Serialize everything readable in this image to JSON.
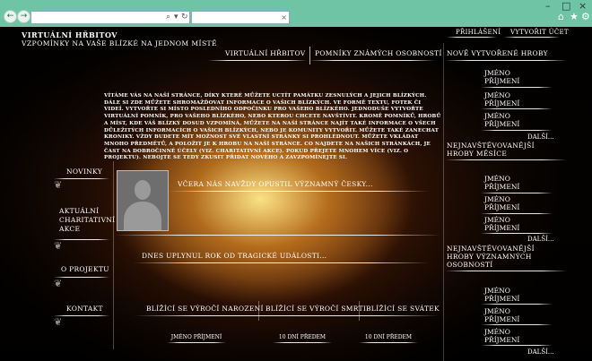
{
  "browser": {
    "back": "←",
    "forward": "→",
    "address_icons": [
      "⌕",
      "▾",
      "↻"
    ],
    "tab_close": "×",
    "window_controls": [
      "–",
      "□",
      "×"
    ],
    "toolbar_icons": [
      "⌂",
      "★",
      "⚙"
    ]
  },
  "header": {
    "logo_line1": "Virtuální hřbitov",
    "logo_line2": "Vzpomínky na vaše blízké na jednom místě",
    "login": "Přihlášení",
    "create_account": "Vytvořit účet"
  },
  "nav": {
    "tab1": "Virtuální hřbitov",
    "tab2": "Pomníky známých osobností"
  },
  "intro_text": "Vítáme Vás na naší stránce, díky které můžete uctít památku zesnulých a jejich blízkých. Dále si zde můžete shromažďovat informace o Vašich blízkých. Ve formě textu, fotek či videí. Vytvořte si místo posledního odpočinku pro Vašeho blízkého. Jednoduše vytvořte virtuální pomník, pro Vašeho blízkého, nebo kterou chcete navštívit. Kromě pomníků, hrobů a míst, kde váš blízký dosud vzpomíná, můžete na naší stránce najít také informace o všech důležitých informacích o vašich blízkých, nebo je komunity vytvořit. Můžete také zanechat kroniky. Vždy budete mít možnost své vlastní stránky si prohlédnout. Můžete vkládat mnoho předmětů, a položit je k hrobu na naší stránce. Co najdete na našich stránkách, je čast na dobročinné účely (viz. Charitativní akce). Pokud přejete mnohem více (viz. O projektu). Nebojte se tedy zkusit přidat nového a zavzpomínejte si.",
  "left_menu": {
    "news": "Novinky",
    "charity_line1": "Aktuální",
    "charity_line2": "charitativní",
    "charity_line3": "akce",
    "about": "O projektu",
    "contact": "Kontakt"
  },
  "news": {
    "item1": "Včera nás navždy opustil významný česky...",
    "item2": "Dnes uplynul rok od tragické události..."
  },
  "bottom": {
    "col1_title": "Blížící se výročí narození",
    "col2_title": "Blížící se výročí smrti",
    "col3_title": "Blížící se svátek",
    "col1_item": "Jméno Příjmení",
    "col2_item": "10 dní předem",
    "col3_item": "10 dní předem"
  },
  "sidebar": {
    "section1_title": "Nově vytvořené hroby",
    "section1_items": [
      {
        "first": "Jméno",
        "last": "Příjmení"
      },
      {
        "first": "Jméno",
        "last": "Příjmení"
      },
      {
        "first": "Jméno",
        "last": "Příjmení"
      }
    ],
    "section2_title_line1": "Nejnavštěvovanější",
    "section2_title_line2": "hroby měsíce",
    "section2_items": [
      {
        "first": "Jméno",
        "last": "Příjmení"
      },
      {
        "first": "Jméno",
        "last": "Příjmení"
      },
      {
        "first": "Jméno",
        "last": "Příjmení"
      }
    ],
    "section3_title_line1": "Nejnavštěvovanější",
    "section3_title_line2": "hroby významných",
    "section3_title_line3": "osobností",
    "section3_items": [
      {
        "first": "Jméno",
        "last": "Příjmení"
      },
      {
        "first": "Jméno",
        "last": "Příjmení"
      },
      {
        "first": "Jméno",
        "last": "Příjmení"
      }
    ],
    "more": "Další..."
  },
  "colors": {
    "chrome": "#6fc4a6",
    "glow": "#f0c860"
  }
}
